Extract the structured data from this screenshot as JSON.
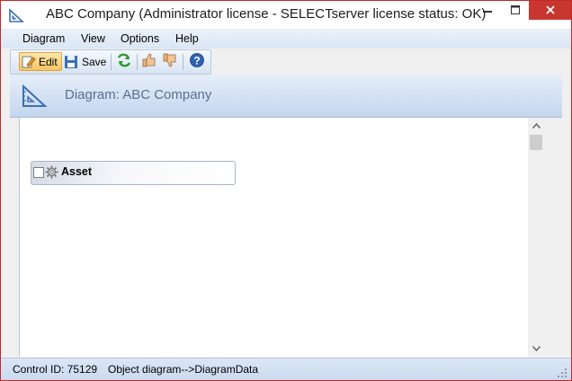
{
  "window": {
    "title": "ABC Company (Administrator license - SELECTserver license status: OK)",
    "icon": "triangle-ruler-icon",
    "controls": [
      "minimize-icon",
      "maximize-icon",
      "close-icon"
    ]
  },
  "menu": {
    "items": [
      {
        "label": "Diagram"
      },
      {
        "label": "View"
      },
      {
        "label": "Options"
      },
      {
        "label": "Help"
      }
    ]
  },
  "toolbar": {
    "edit_label": "Edit",
    "save_label": "Save",
    "icons": [
      "edit-icon",
      "save-icon",
      "refresh-icon",
      "thumbs-up-icon",
      "thumbs-down-icon",
      "help-icon"
    ]
  },
  "header": {
    "title": "Diagram: ABC Company",
    "icon": "triangle-ruler-icon"
  },
  "diagram": {
    "nodes": [
      {
        "label": "Asset",
        "checked": false,
        "icon": "gear-icon"
      }
    ]
  },
  "status": {
    "control_id": "Control ID: 75129",
    "path": "Object diagram-->DiagramData"
  },
  "colors": {
    "close_button": "#c7372f",
    "accent_blue": "#4a78b5",
    "header_text": "#5b6f8e"
  }
}
